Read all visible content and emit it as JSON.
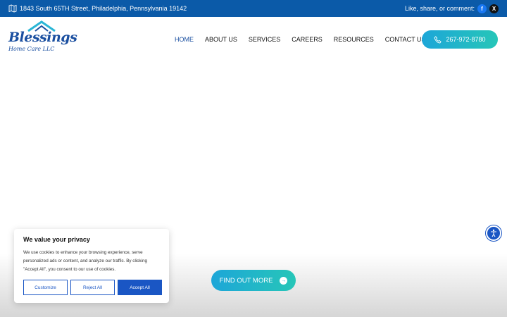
{
  "topbar": {
    "address": "1843 South 65TH Street, Philadelphia, Pennsylvania 19142",
    "share_label": "Like, share, or comment:",
    "icons": [
      "map-icon",
      "facebook-icon",
      "x-icon"
    ]
  },
  "logo": {
    "name": "Blessings",
    "subtitle": "Home Care LLC"
  },
  "nav": {
    "items": [
      {
        "label": "HOME"
      },
      {
        "label": "ABOUT US"
      },
      {
        "label": "SERVICES"
      },
      {
        "label": "CAREERS"
      },
      {
        "label": "RESOURCES"
      },
      {
        "label": "CONTACT US"
      }
    ]
  },
  "phone": {
    "label": "267-972-8780"
  },
  "hero": {
    "button_label": "FIND OUT MORE"
  },
  "cookie": {
    "title": "We value your privacy",
    "body": "We use cookies to enhance your browsing experience, serve personalized ads or content, and analyze our traffic. By clicking \"Accept All\", you consent to our use of cookies.",
    "customize_label": "Customize",
    "reject_label": "Reject All",
    "accept_label": "Accept All"
  },
  "colors": {
    "topbar": "#0b5aa8",
    "brand": "#1a4fa0",
    "gradient_start": "#1da6d8",
    "gradient_end": "#26c6b8",
    "cookie_primary": "#1a56c4"
  }
}
